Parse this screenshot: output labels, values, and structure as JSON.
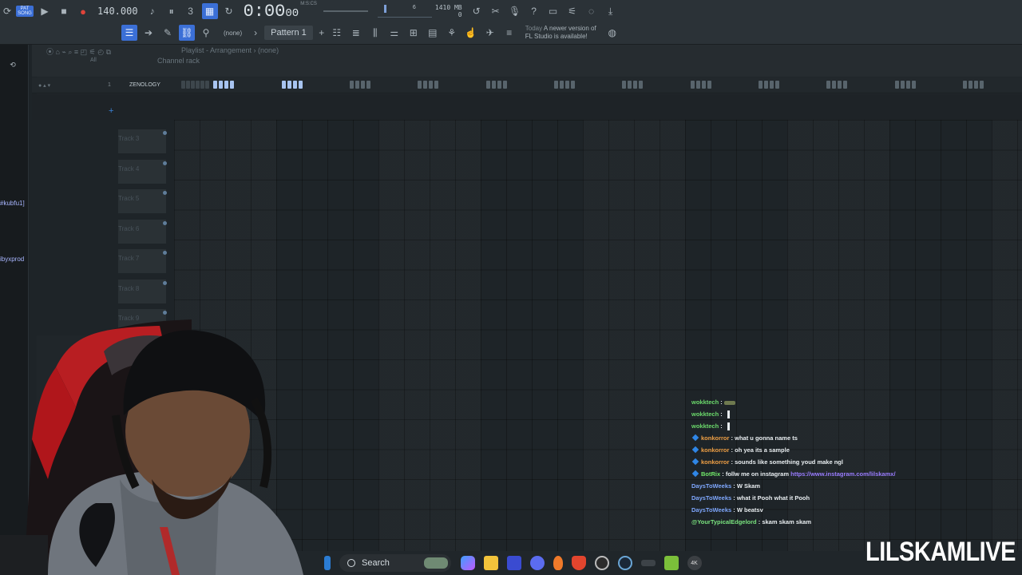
{
  "toolbar": {
    "pat_song_badge": "PAT",
    "song_label": "SONG",
    "tempo": "140.000",
    "time": "0:00",
    "time_frac": "00",
    "time_unit": "M:S:CS",
    "meter_value": "6",
    "memory": "1410 MB",
    "cpu": "0",
    "pattern": "Pattern 1",
    "snap": "(none)",
    "news_today": "Today",
    "news_line1": "A newer version of",
    "news_line2": "FL Studio is available!"
  },
  "playlist": {
    "title": "Playlist - Arrangement",
    "title_suffix": "(none)",
    "channel_rack": "Channel rack",
    "filter": "All",
    "pattern_number": "1",
    "pattern_name": "ZENOLOGY",
    "tracks": [
      "Track 3",
      "Track 4",
      "Track 5",
      "Track 6",
      "Track 7",
      "Track 8",
      "Track 9"
    ]
  },
  "left_strip": {
    "tag1": "#kubfu1]",
    "tag2": "ibyxprod"
  },
  "chat": [
    {
      "user": "wokktech",
      "color": "#6bd96b",
      "text": "",
      "emote": "tank"
    },
    {
      "user": "wokktech",
      "color": "#6bd96b",
      "text": "",
      "emote": "fig"
    },
    {
      "user": "wokktech",
      "color": "#6bd96b",
      "text": "",
      "emote": "fig"
    },
    {
      "user": "konkorror",
      "color": "#f0a045",
      "text": "what u gonna name ts",
      "badge": true
    },
    {
      "user": "konkorror",
      "color": "#f0a045",
      "text": "oh yea its a sample",
      "badge": true
    },
    {
      "user": "konkorror",
      "color": "#f0a045",
      "text": "sounds like something youd make ngl",
      "badge": true
    },
    {
      "user": "BotRix",
      "color": "#72e86a",
      "text": "follw me on instagram",
      "link": "https://www.instagram.com/lilskamx/",
      "badge": true
    },
    {
      "user": "DaysToWeeks",
      "color": "#7fa8ff",
      "text": "W Skam"
    },
    {
      "user": "DaysToWeeks",
      "color": "#7fa8ff",
      "text": "what it Pooh what it Pooh"
    },
    {
      "user": "DaysToWeeks",
      "color": "#7fa8ff",
      "text": "W beatsv"
    },
    {
      "user": "@YourTypicalEdgelord",
      "color": "#79e27e",
      "text": "skam skam skam"
    }
  ],
  "taskbar": {
    "search_label": "Search",
    "icons": [
      "start-icon",
      "widgets-icon",
      "copilot-icon",
      "file-explorer-icon",
      "store-icon",
      "discord-icon",
      "fl-studio-icon",
      "brave-icon",
      "obs-icon",
      "steam-icon",
      "app-icon",
      "game-icon",
      "4k-icon"
    ]
  },
  "watermark": "LILSKAMLIVE",
  "colors": {
    "accent": "#3b6fd6",
    "link": "#9a7cff",
    "record": "#e0443a"
  }
}
